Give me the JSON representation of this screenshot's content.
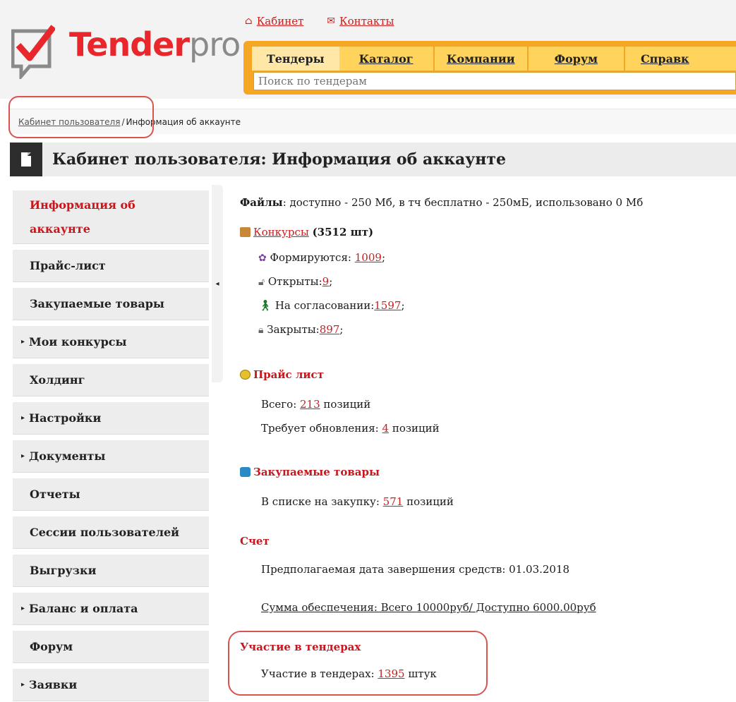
{
  "header": {
    "logo_left": "Tender",
    "logo_right": "pro",
    "top_links": [
      {
        "label": "Кабинет",
        "icon": "home-icon"
      },
      {
        "label": "Контакты",
        "icon": "mail-icon"
      }
    ],
    "tabs": [
      "Тендеры",
      "Каталог",
      "Компании",
      "Форум",
      "Справк"
    ],
    "search_placeholder": "Поиск по тендерам"
  },
  "breadcrumb": {
    "link": "Кабинет пользователя",
    "separator": "/",
    "current": "Информация об аккаунте"
  },
  "page_title": "Кабинет пользователя: Информация об аккаунте",
  "sidebar": {
    "items": [
      {
        "label": "Информация об",
        "label2": "аккаунте",
        "active": true
      },
      {
        "label": "Прайс-лист"
      },
      {
        "label": "Закупаемые товары"
      },
      {
        "label": "Мои конкурсы",
        "arrow": "▸"
      },
      {
        "label": "Холдинг"
      },
      {
        "label": "Настройки",
        "arrow": "▸"
      },
      {
        "label": "Документы",
        "arrow": "▸"
      },
      {
        "label": "Отчеты"
      },
      {
        "label": "Сессии пользователей"
      },
      {
        "label": "Выгрузки"
      },
      {
        "label": "Баланс и оплата",
        "arrow": "▸"
      },
      {
        "label": "Форум"
      },
      {
        "label": "Заявки",
        "arrow": "▸"
      }
    ],
    "collapse_glyph": "◂"
  },
  "main": {
    "files": {
      "label": "Файлы",
      "text": ": доступно - 250 Мб, в тч бесплатно - 250мБ, использовано 0 Мб"
    },
    "contests": {
      "link": "Конкурсы",
      "count": "(3512 шт)",
      "forming_label": "Формируются: ",
      "forming_value": "1009",
      "open_label": "Открыты:",
      "open_value": "9",
      "approval_label": "На согласовании:",
      "approval_value": "1597",
      "closed_label": "Закрыты:",
      "closed_value": "897",
      "end": ";"
    },
    "pricelist": {
      "title": "Прайс лист",
      "total_label": "Всего: ",
      "total_value": "213",
      "total_suffix": " позиций",
      "update_label": "Требует обновления: ",
      "update_value": "4",
      "update_suffix": " позиций"
    },
    "purchases": {
      "title": "Закупаемые товары",
      "label": "В списке на закупку: ",
      "value": "571",
      "suffix": " позиций"
    },
    "account": {
      "title": "Счет",
      "expiry": "Предполагаемая дата завершения средств: 01.03.2018",
      "security": "Сумма обеспечения: Всего 10000руб/ Доступно 6000.00руб"
    },
    "participation": {
      "title": "Участие в тендерах",
      "label": "Участие в тендерах: ",
      "value": "1395",
      "suffix": " штук"
    }
  },
  "colors": {
    "brand_red": "#e8262b",
    "nav_orange": "#f5a623",
    "highlight": "#d9534f"
  }
}
